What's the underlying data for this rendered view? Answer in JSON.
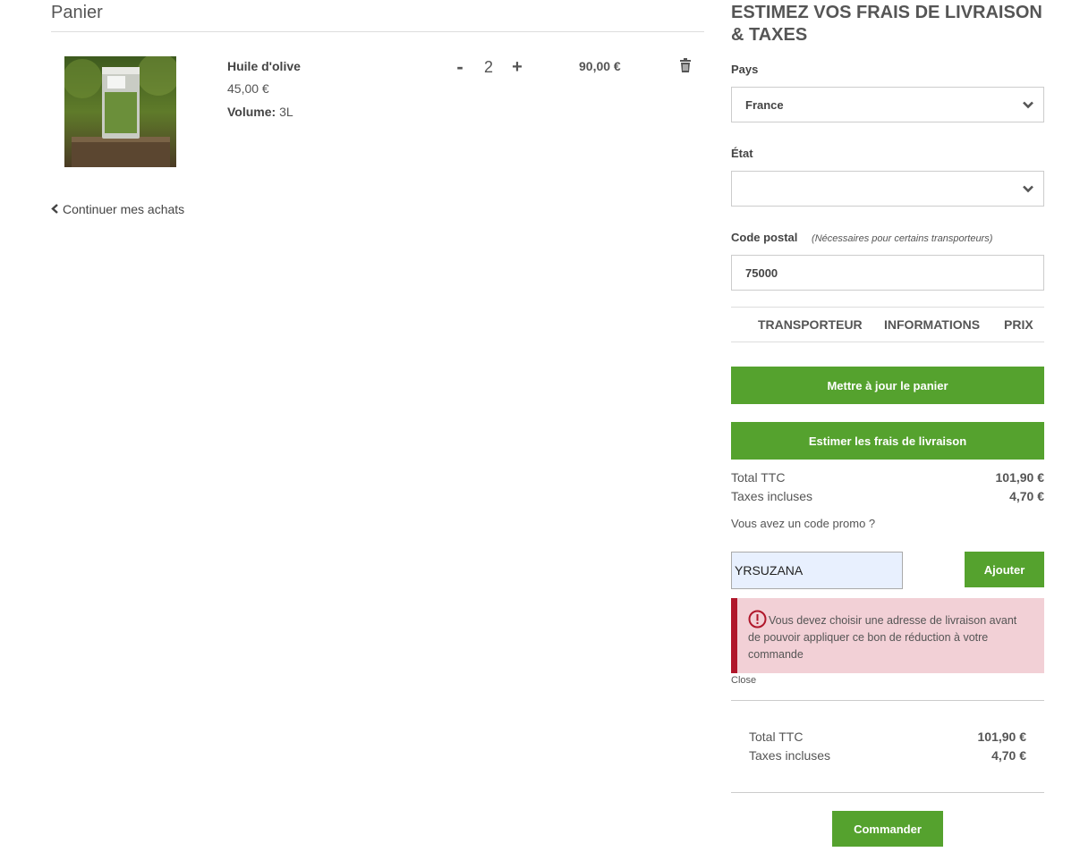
{
  "cart": {
    "title": "Panier",
    "item": {
      "name": "Huile d'olive",
      "unit_price": "45,00 €",
      "attr_label": "Volume:",
      "attr_value": "3L",
      "qty_minus": "-",
      "quantity": "2",
      "qty_plus": "+",
      "line_total": "90,00 €"
    },
    "continue_label": "Continuer mes achats"
  },
  "shipping": {
    "title": "ESTIMEZ VOS FRAIS DE LIVRAISON & TAXES",
    "country_label": "Pays",
    "country_value": "France",
    "state_label": "État",
    "state_value": "",
    "postcode_label": "Code postal",
    "postcode_note": "(Nécessaires pour certains transporteurs)",
    "postcode_value": "75000",
    "col_carrier": "TRANSPORTEUR",
    "col_info": "INFORMATIONS",
    "col_price": "PRIX",
    "update_cart": "Mettre à jour le panier",
    "estimate": "Estimer les frais de livraison"
  },
  "totals": {
    "total_label": "Total TTC",
    "total_value": "101,90 €",
    "tax_label": "Taxes incluses",
    "tax_value": "4,70 €"
  },
  "promo": {
    "question": "Vous avez un code promo ?",
    "code_value": "YRSUZANA",
    "add_label": "Ajouter",
    "error_message": "Vous devez choisir une adresse de livraison avant de pouvoir appliquer ce bon de réduction à votre commande",
    "close_label": "Close"
  },
  "summary": {
    "total_label": "Total TTC",
    "total_value": "101,90 €",
    "tax_label": "Taxes incluses",
    "tax_value": "4,70 €",
    "order_label": "Commander"
  },
  "colors": {
    "accent_green": "#55a22e",
    "alert_bg": "#f2d0d6",
    "alert_border": "#b0172b"
  },
  "icons": {
    "back": "chevron-left-icon",
    "delete": "trash-icon",
    "dropdown": "chevron-down-icon",
    "error": "exclamation-circle-icon"
  }
}
